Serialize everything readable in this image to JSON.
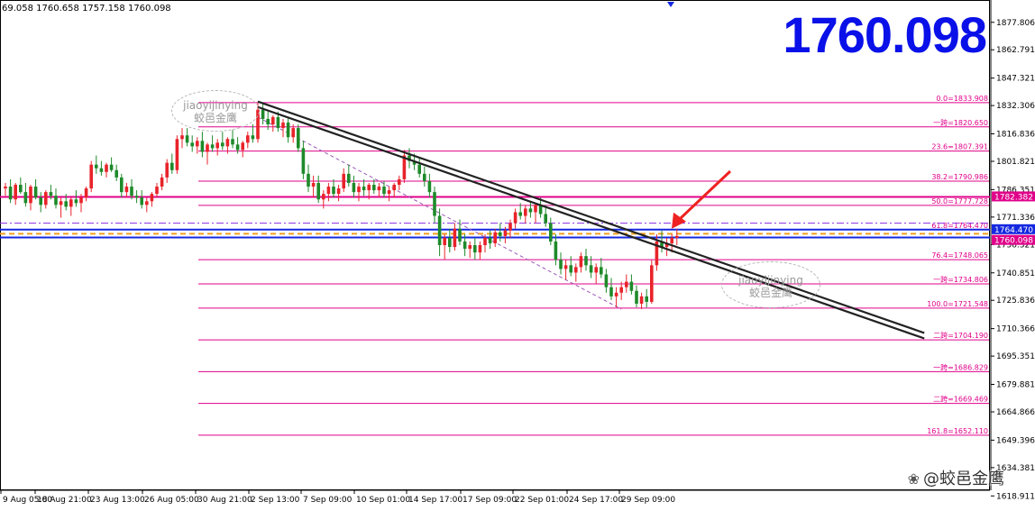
{
  "header": {
    "ohlc_text": "69.058 1760.658 1757.158 1760.098"
  },
  "current_price_big": "1760.098",
  "watermarks": [
    {
      "text_en": "jiaoyijinying",
      "text_cn": "蛟邑金鹰"
    },
    {
      "text_en": "jiaoyijinying",
      "text_cn": "蛟邑金鹰"
    }
  ],
  "brand": {
    "icon": "weibo-icon",
    "text": "@蛟邑金鹰"
  },
  "colors": {
    "bull": "#e8232a",
    "bear": "#1e8a2a",
    "fib": "#e0008a",
    "trend": "#222222",
    "blue": "#1428e0",
    "orange": "#f0a020",
    "violet": "#8a2be2",
    "arrow": "#ee2222"
  },
  "chart_data": {
    "type": "candlestick",
    "ylim": [
      1622.0,
      1890.0
    ],
    "y_ticks": [
      "1877.806",
      "1862.791",
      "1847.321",
      "1832.306",
      "1816.836",
      "1801.821",
      "1786.351",
      "1771.336",
      "1756.321",
      "1740.851",
      "1725.836",
      "1710.366",
      "1695.351",
      "1679.881",
      "1664.866",
      "1649.396",
      "1634.381",
      "1618.911"
    ],
    "x_ticks": [
      "9 Aug 05:00",
      "18 Aug 21:00",
      "23 Aug 13:00",
      "26 Aug 05:00",
      "30 Aug 21:00",
      "2 Sep 13:00",
      "7 Sep 09:00",
      "10 Sep 01:00",
      "14 Sep 17:00",
      "17 Sep 09:00",
      "22 Sep 01:00",
      "24 Sep 17:00",
      "29 Sep 09:00"
    ],
    "fib_levels": [
      {
        "label": "0.0=1833.908",
        "value": 1833.908
      },
      {
        "label": "一跨=1820.650",
        "value": 1820.65
      },
      {
        "label": "23.6=1807.391",
        "value": 1807.391
      },
      {
        "label": "38.2=1790.986",
        "value": 1790.986
      },
      {
        "label": "50.0=1777.728",
        "value": 1777.728
      },
      {
        "label": "61.8=1764.470",
        "value": 1764.47
      },
      {
        "label": "76.4=1748.065",
        "value": 1748.065
      },
      {
        "label": "一跨=1734.806",
        "value": 1734.806
      },
      {
        "label": "100.0=1721.548",
        "value": 1721.548
      },
      {
        "label": "二跨=1704.190",
        "value": 1704.19
      },
      {
        "label": "一跨=1686.829",
        "value": 1686.829
      },
      {
        "label": "二跨=1669.469",
        "value": 1669.469
      },
      {
        "label": "161.8=1652.110",
        "value": 1652.11
      }
    ],
    "price_tags": [
      {
        "label": "1782.382",
        "value": 1782.382,
        "bg": "#e0008a"
      },
      {
        "label": "1764.470",
        "value": 1764.47,
        "bg": "#1428e0"
      },
      {
        "label": "1760.098",
        "value": 1760.098,
        "bg": "#e0008a"
      }
    ],
    "horizontal_lines": [
      {
        "value": 1782.382,
        "color": "#e0008a",
        "style": "solid",
        "width": 2
      },
      {
        "value": 1768.0,
        "color": "#8a2be2",
        "style": "dashdot",
        "width": 1
      },
      {
        "value": 1764.47,
        "color": "#1428e0",
        "style": "solid",
        "width": 2
      },
      {
        "value": 1762.2,
        "color": "#f0a020",
        "style": "dashed",
        "width": 2
      },
      {
        "value": 1760.2,
        "color": "#1428e0",
        "style": "solid",
        "width": 2
      }
    ],
    "trend_channel": {
      "start_index": 50,
      "start_value": 1834.5,
      "end_index": 182,
      "end_value": 1708.0,
      "offset": 3.0
    },
    "dashed_trend": {
      "start_index": 50,
      "start_value": 1826.0,
      "end_index": 122,
      "end_value": 1721.0
    },
    "candles": [
      [
        1787,
        1790,
        1783,
        1788
      ],
      [
        1788,
        1792,
        1779,
        1781
      ],
      [
        1781,
        1790,
        1778,
        1789
      ],
      [
        1789,
        1793,
        1784,
        1785
      ],
      [
        1785,
        1790,
        1777,
        1779
      ],
      [
        1779,
        1789,
        1775,
        1788
      ],
      [
        1788,
        1792,
        1781,
        1782
      ],
      [
        1782,
        1785,
        1774,
        1778
      ],
      [
        1778,
        1786,
        1776,
        1785
      ],
      [
        1785,
        1789,
        1781,
        1783
      ],
      [
        1783,
        1787,
        1776,
        1778
      ],
      [
        1778,
        1782,
        1771,
        1780
      ],
      [
        1780,
        1784,
        1775,
        1777
      ],
      [
        1777,
        1782,
        1772,
        1781
      ],
      [
        1781,
        1786,
        1777,
        1779
      ],
      [
        1779,
        1784,
        1774,
        1782
      ],
      [
        1782,
        1788,
        1780,
        1787
      ],
      [
        1787,
        1802,
        1785,
        1800
      ],
      [
        1800,
        1805,
        1795,
        1798
      ],
      [
        1798,
        1802,
        1794,
        1796
      ],
      [
        1796,
        1801,
        1793,
        1800
      ],
      [
        1800,
        1804,
        1796,
        1797
      ],
      [
        1797,
        1800,
        1791,
        1793
      ],
      [
        1793,
        1795,
        1782,
        1785
      ],
      [
        1785,
        1790,
        1782,
        1788
      ],
      [
        1788,
        1792,
        1781,
        1783
      ],
      [
        1783,
        1786,
        1779,
        1782
      ],
      [
        1782,
        1786,
        1776,
        1778
      ],
      [
        1778,
        1782,
        1774,
        1780
      ],
      [
        1780,
        1785,
        1777,
        1784
      ],
      [
        1784,
        1790,
        1782,
        1788
      ],
      [
        1788,
        1795,
        1786,
        1793
      ],
      [
        1793,
        1803,
        1790,
        1801
      ],
      [
        1801,
        1806,
        1795,
        1797
      ],
      [
        1797,
        1816,
        1795,
        1814
      ],
      [
        1814,
        1820,
        1809,
        1816
      ],
      [
        1816,
        1820,
        1810,
        1812
      ],
      [
        1812,
        1816,
        1807,
        1810
      ],
      [
        1810,
        1815,
        1806,
        1813
      ],
      [
        1813,
        1818,
        1804,
        1807
      ],
      [
        1807,
        1812,
        1800,
        1811
      ],
      [
        1811,
        1816,
        1807,
        1809
      ],
      [
        1809,
        1814,
        1805,
        1812
      ],
      [
        1812,
        1818,
        1808,
        1810
      ],
      [
        1810,
        1815,
        1806,
        1814
      ],
      [
        1814,
        1819,
        1809,
        1811
      ],
      [
        1811,
        1815,
        1806,
        1808
      ],
      [
        1808,
        1813,
        1804,
        1812
      ],
      [
        1812,
        1818,
        1809,
        1816
      ],
      [
        1816,
        1822,
        1812,
        1814
      ],
      [
        1814,
        1834,
        1812,
        1830
      ],
      [
        1830,
        1834,
        1822,
        1825
      ],
      [
        1825,
        1829,
        1819,
        1822
      ],
      [
        1822,
        1827,
        1818,
        1826
      ],
      [
        1826,
        1829,
        1818,
        1820
      ],
      [
        1820,
        1825,
        1815,
        1823
      ],
      [
        1823,
        1826,
        1812,
        1815
      ],
      [
        1815,
        1822,
        1812,
        1820
      ],
      [
        1820,
        1822,
        1807,
        1809
      ],
      [
        1809,
        1813,
        1792,
        1795
      ],
      [
        1795,
        1800,
        1785,
        1788
      ],
      [
        1788,
        1794,
        1782,
        1790
      ],
      [
        1790,
        1794,
        1779,
        1781
      ],
      [
        1781,
        1786,
        1776,
        1784
      ],
      [
        1784,
        1790,
        1780,
        1788
      ],
      [
        1788,
        1792,
        1782,
        1784
      ],
      [
        1784,
        1789,
        1780,
        1787
      ],
      [
        1787,
        1798,
        1785,
        1795
      ],
      [
        1795,
        1800,
        1788,
        1790
      ],
      [
        1790,
        1794,
        1782,
        1785
      ],
      [
        1785,
        1790,
        1780,
        1788
      ],
      [
        1788,
        1792,
        1783,
        1786
      ],
      [
        1786,
        1790,
        1781,
        1789
      ],
      [
        1789,
        1792,
        1784,
        1786
      ],
      [
        1786,
        1790,
        1782,
        1788
      ],
      [
        1788,
        1791,
        1782,
        1784
      ],
      [
        1784,
        1788,
        1780,
        1786
      ],
      [
        1786,
        1790,
        1782,
        1789
      ],
      [
        1789,
        1794,
        1786,
        1792
      ],
      [
        1792,
        1808,
        1790,
        1805
      ],
      [
        1805,
        1809,
        1798,
        1802
      ],
      [
        1802,
        1806,
        1797,
        1800
      ],
      [
        1800,
        1804,
        1793,
        1795
      ],
      [
        1795,
        1799,
        1788,
        1791
      ],
      [
        1791,
        1795,
        1782,
        1785
      ],
      [
        1785,
        1788,
        1768,
        1772
      ],
      [
        1772,
        1776,
        1750,
        1756
      ],
      [
        1756,
        1762,
        1748,
        1760
      ],
      [
        1760,
        1765,
        1752,
        1755
      ],
      [
        1755,
        1768,
        1753,
        1765
      ],
      [
        1765,
        1770,
        1756,
        1758
      ],
      [
        1758,
        1762,
        1750,
        1754
      ],
      [
        1754,
        1758,
        1749,
        1756
      ],
      [
        1756,
        1760,
        1748,
        1752
      ],
      [
        1752,
        1758,
        1748,
        1756
      ],
      [
        1756,
        1762,
        1752,
        1760
      ],
      [
        1760,
        1764,
        1754,
        1757
      ],
      [
        1757,
        1765,
        1755,
        1763
      ],
      [
        1763,
        1768,
        1758,
        1761
      ],
      [
        1761,
        1766,
        1757,
        1764
      ],
      [
        1764,
        1770,
        1760,
        1768
      ],
      [
        1768,
        1776,
        1765,
        1774
      ],
      [
        1774,
        1779,
        1770,
        1772
      ],
      [
        1772,
        1778,
        1768,
        1776
      ],
      [
        1776,
        1780,
        1771,
        1774
      ],
      [
        1774,
        1779,
        1768,
        1778
      ],
      [
        1778,
        1782,
        1771,
        1773
      ],
      [
        1773,
        1778,
        1766,
        1768
      ],
      [
        1768,
        1771,
        1756,
        1758
      ],
      [
        1758,
        1762,
        1745,
        1748
      ],
      [
        1748,
        1752,
        1740,
        1743
      ],
      [
        1743,
        1748,
        1737,
        1745
      ],
      [
        1745,
        1750,
        1739,
        1741
      ],
      [
        1741,
        1746,
        1736,
        1744
      ],
      [
        1744,
        1752,
        1741,
        1750
      ],
      [
        1750,
        1754,
        1742,
        1745
      ],
      [
        1745,
        1750,
        1738,
        1741
      ],
      [
        1741,
        1746,
        1735,
        1744
      ],
      [
        1744,
        1749,
        1738,
        1740
      ],
      [
        1740,
        1743,
        1730,
        1733
      ],
      [
        1733,
        1738,
        1726,
        1728
      ],
      [
        1728,
        1733,
        1722,
        1730
      ],
      [
        1730,
        1736,
        1726,
        1733
      ],
      [
        1733,
        1740,
        1730,
        1736
      ],
      [
        1736,
        1740,
        1729,
        1731
      ],
      [
        1731,
        1734,
        1722,
        1724
      ],
      [
        1724,
        1730,
        1721,
        1728
      ],
      [
        1728,
        1732,
        1722,
        1725
      ],
      [
        1725,
        1748,
        1724,
        1745
      ],
      [
        1745,
        1762,
        1742,
        1758
      ],
      [
        1758,
        1764,
        1752,
        1755
      ],
      [
        1755,
        1760,
        1750,
        1757
      ],
      [
        1757,
        1762,
        1752,
        1760
      ],
      [
        1760,
        1765,
        1756,
        1761
      ]
    ]
  }
}
